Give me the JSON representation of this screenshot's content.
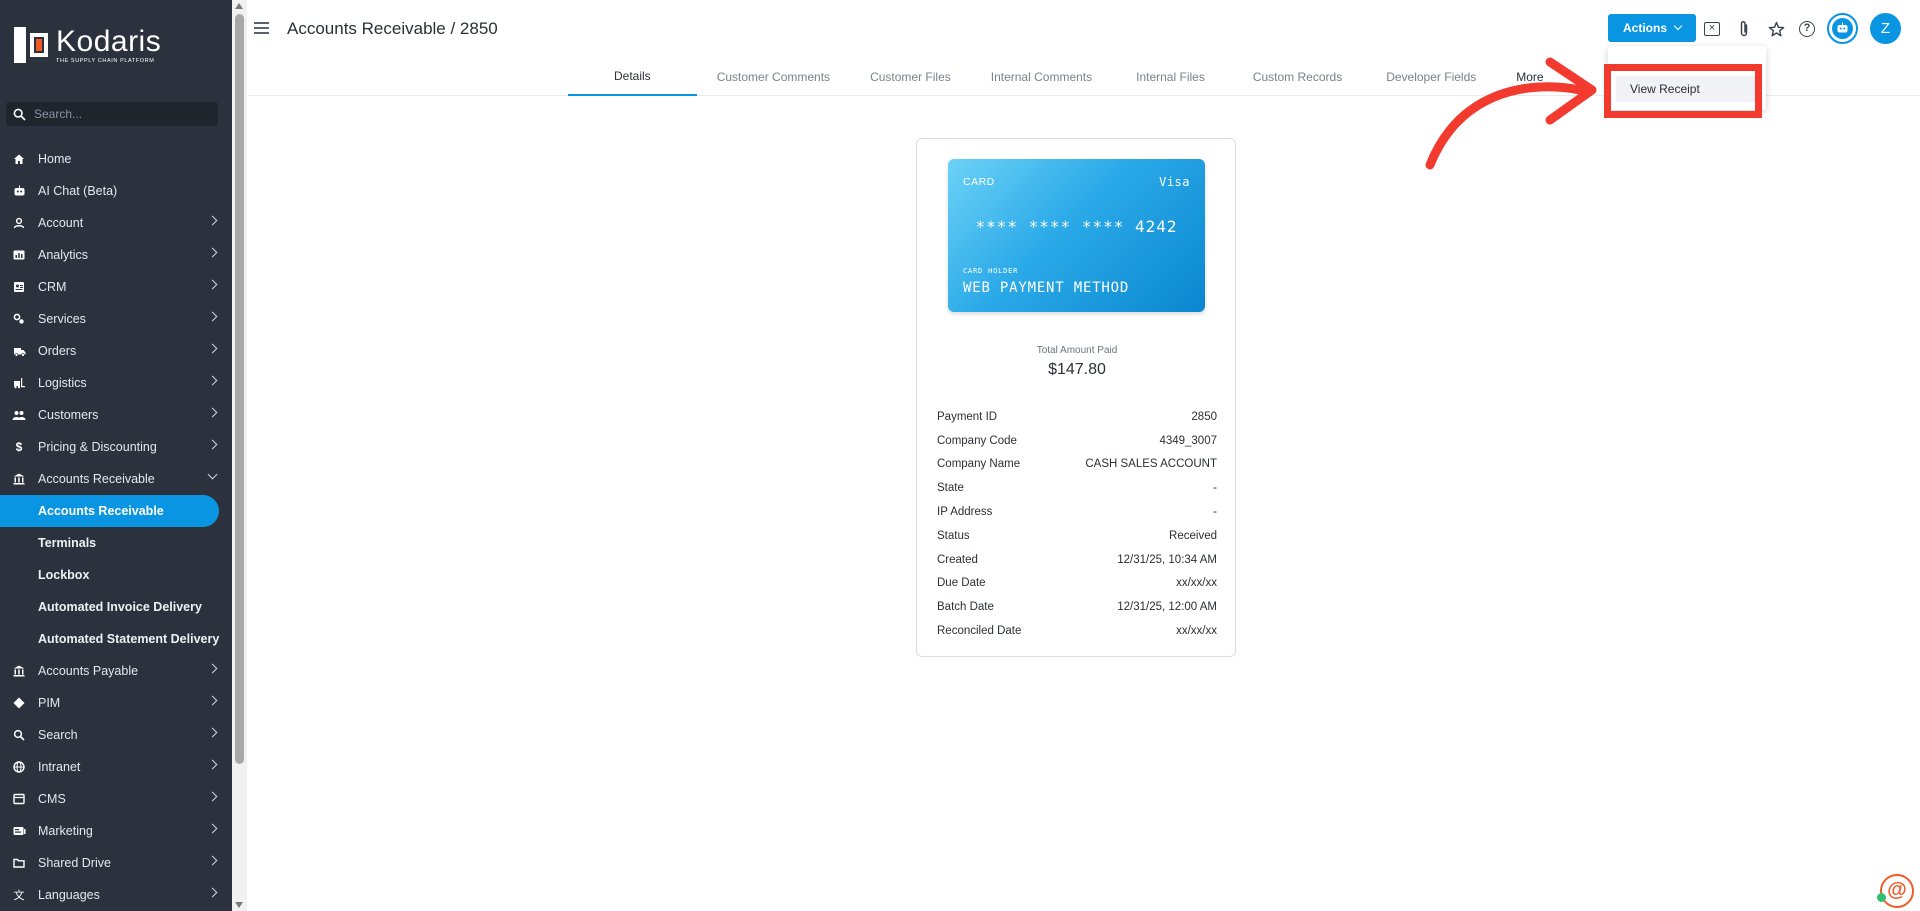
{
  "sidebar": {
    "brand_name": "Kodaris",
    "brand_tagline": "THE SUPPLY CHAIN PLATFORM",
    "search_placeholder": "Search...",
    "items": [
      {
        "label": "Home",
        "icon": "home-icon"
      },
      {
        "label": "AI Chat (Beta)",
        "icon": "robot-icon"
      },
      {
        "label": "Account",
        "icon": "user-icon"
      },
      {
        "label": "Analytics",
        "icon": "analytics-icon"
      },
      {
        "label": "CRM",
        "icon": "contact-card-icon"
      },
      {
        "label": "Services",
        "icon": "services-icon"
      },
      {
        "label": "Orders",
        "icon": "truck-icon"
      },
      {
        "label": "Logistics",
        "icon": "forklift-icon"
      },
      {
        "label": "Customers",
        "icon": "people-icon"
      },
      {
        "label": "Pricing & Discounting",
        "icon": "dollar-icon"
      },
      {
        "label": "Accounts Receivable",
        "icon": "bank-icon"
      }
    ],
    "sub_items": [
      {
        "label": "Accounts Receivable",
        "active": true
      },
      {
        "label": "Terminals"
      },
      {
        "label": "Lockbox"
      },
      {
        "label": "Automated Invoice Delivery"
      },
      {
        "label": "Automated Statement Delivery"
      }
    ],
    "items_after": [
      {
        "label": "Accounts Payable",
        "icon": "bank-icon"
      },
      {
        "label": "PIM",
        "icon": "tag-icon"
      },
      {
        "label": "Search",
        "icon": "search-icon"
      },
      {
        "label": "Intranet",
        "icon": "globe-icon"
      },
      {
        "label": "CMS",
        "icon": "cms-icon"
      },
      {
        "label": "Marketing",
        "icon": "marketing-icon"
      },
      {
        "label": "Shared Drive",
        "icon": "folder-icon"
      },
      {
        "label": "Languages",
        "icon": "translate-icon"
      }
    ]
  },
  "header": {
    "title": "Accounts Receivable / 2850",
    "actions_label": "Actions",
    "avatar_initial": "Z"
  },
  "tabs": [
    {
      "label": "Details",
      "active": true
    },
    {
      "label": "Customer Comments"
    },
    {
      "label": "Customer Files"
    },
    {
      "label": "Internal Comments"
    },
    {
      "label": "Internal Files"
    },
    {
      "label": "Custom Records"
    },
    {
      "label": "Developer Fields"
    },
    {
      "label": "More"
    }
  ],
  "dropdown": {
    "option": "View Receipt"
  },
  "card": {
    "type_label": "CARD",
    "brand": "Visa",
    "number": "**** **** **** 4242",
    "holder_label": "CARD HOLDER",
    "holder": "WEB PAYMENT METHOD"
  },
  "total": {
    "label": "Total Amount Paid",
    "value": "$147.80"
  },
  "details": [
    {
      "label": "Payment ID",
      "value": "2850"
    },
    {
      "label": "Company Code",
      "value": "4349_3007"
    },
    {
      "label": "Company Name",
      "value": "CASH SALES ACCOUNT"
    },
    {
      "label": "State",
      "value": "-"
    },
    {
      "label": "IP Address",
      "value": "-"
    },
    {
      "label": "Status",
      "value": "Received"
    },
    {
      "label": "Created",
      "value": "12/31/25, 10:34 AM"
    },
    {
      "label": "Due Date",
      "value": "xx/xx/xx"
    },
    {
      "label": "Batch Date",
      "value": "12/31/25, 12:00 AM"
    },
    {
      "label": "Reconciled Date",
      "value": "xx/xx/xx"
    }
  ],
  "colors": {
    "accent": "#0a95e3",
    "sidebar_bg": "#2b323d",
    "highlight": "#f33a2f",
    "brand_orange": "#f05a28"
  }
}
